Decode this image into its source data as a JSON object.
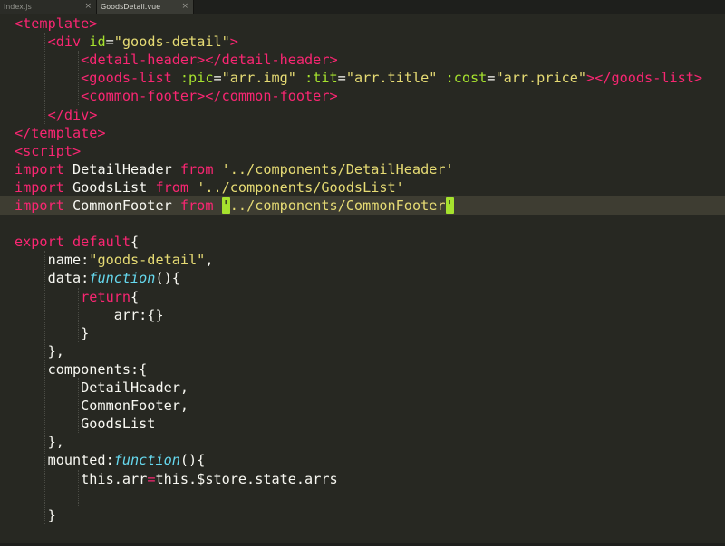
{
  "tabs": [
    {
      "label": "index.js",
      "close_label": "×",
      "active": false
    },
    {
      "label": "GoodsDetail.vue",
      "close_label": "×",
      "active": true
    }
  ],
  "theme": {
    "background": "#272822",
    "tag": "#f92672",
    "attribute": "#a6e22e",
    "string": "#e6db74",
    "function": "#66d9ef",
    "text": "#f8f8f2",
    "current_line": "#3e3d32"
  },
  "code": {
    "current_line_index": 10,
    "lines": [
      [
        [
          "tag",
          "<template>"
        ]
      ],
      [
        [
          "text",
          "    "
        ],
        [
          "tag",
          "<div"
        ],
        [
          "text",
          " "
        ],
        [
          "attr",
          "id"
        ],
        [
          "text",
          "="
        ],
        [
          "str",
          "\"goods-detail\""
        ],
        [
          "tag",
          ">"
        ]
      ],
      [
        [
          "text",
          "        "
        ],
        [
          "tag",
          "<detail-header></detail-header>"
        ]
      ],
      [
        [
          "text",
          "        "
        ],
        [
          "tag",
          "<goods-list"
        ],
        [
          "text",
          " "
        ],
        [
          "attr",
          ":pic"
        ],
        [
          "text",
          "="
        ],
        [
          "str",
          "\"arr.img\""
        ],
        [
          "text",
          " "
        ],
        [
          "attr",
          ":tit"
        ],
        [
          "text",
          "="
        ],
        [
          "str",
          "\"arr.title\""
        ],
        [
          "text",
          " "
        ],
        [
          "attr",
          ":cost"
        ],
        [
          "text",
          "="
        ],
        [
          "str",
          "\"arr.price\""
        ],
        [
          "tag",
          "></goods-list>"
        ]
      ],
      [
        [
          "text",
          "        "
        ],
        [
          "tag",
          "<common-footer></common-footer>"
        ]
      ],
      [
        [
          "text",
          "    "
        ],
        [
          "tag",
          "</div>"
        ]
      ],
      [
        [
          "tag",
          "</template>"
        ]
      ],
      [
        [
          "tag",
          "<script>"
        ]
      ],
      [
        [
          "kw",
          "import"
        ],
        [
          "text",
          " DetailHeader "
        ],
        [
          "kw",
          "from"
        ],
        [
          "text",
          " "
        ],
        [
          "str",
          "'../components/DetailHeader'"
        ]
      ],
      [
        [
          "kw",
          "import"
        ],
        [
          "text",
          " GoodsList "
        ],
        [
          "kw",
          "from"
        ],
        [
          "text",
          " "
        ],
        [
          "str",
          "'../components/GoodsList'"
        ]
      ],
      [
        [
          "kw",
          "import"
        ],
        [
          "text",
          " CommonFooter "
        ],
        [
          "kw",
          "from"
        ],
        [
          "text",
          " "
        ],
        [
          "hl",
          "'"
        ],
        [
          "str",
          "../components/CommonFooter"
        ],
        [
          "hl",
          "'"
        ]
      ],
      [],
      [
        [
          "kw",
          "export"
        ],
        [
          "text",
          " "
        ],
        [
          "kw",
          "default"
        ],
        [
          "text",
          "{"
        ]
      ],
      [
        [
          "text",
          "    name:"
        ],
        [
          "str",
          "\"goods-detail\""
        ],
        [
          "text",
          ","
        ]
      ],
      [
        [
          "text",
          "    data:"
        ],
        [
          "fn",
          "function"
        ],
        [
          "text",
          "(){"
        ]
      ],
      [
        [
          "text",
          "        "
        ],
        [
          "kw",
          "return"
        ],
        [
          "text",
          "{"
        ]
      ],
      [
        [
          "text",
          "            arr:{}"
        ]
      ],
      [
        [
          "text",
          "        }"
        ]
      ],
      [
        [
          "text",
          "    },"
        ]
      ],
      [
        [
          "text",
          "    components:{"
        ]
      ],
      [
        [
          "text",
          "        DetailHeader,"
        ]
      ],
      [
        [
          "text",
          "        CommonFooter,"
        ]
      ],
      [
        [
          "text",
          "        GoodsList"
        ]
      ],
      [
        [
          "text",
          "    },"
        ]
      ],
      [
        [
          "text",
          "    mounted:"
        ],
        [
          "fn",
          "function"
        ],
        [
          "text",
          "(){"
        ]
      ],
      [
        [
          "text",
          "        this.arr"
        ],
        [
          "kw",
          "="
        ],
        [
          "text",
          "this.$store.state.arrs"
        ]
      ],
      [],
      [
        [
          "text",
          "    }"
        ]
      ]
    ]
  }
}
